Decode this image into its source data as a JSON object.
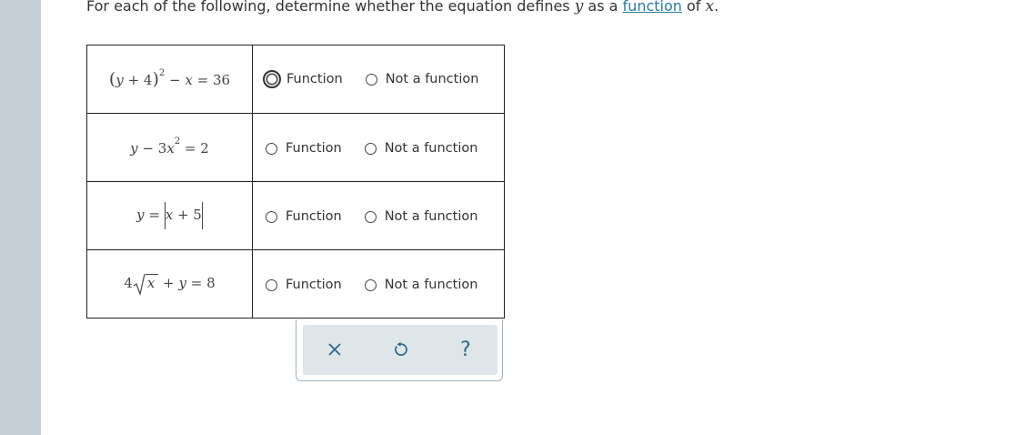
{
  "prompt": {
    "text_before": "For each of the following, determine whether the equation defines ",
    "var_y": "y",
    "text_middle": " as a ",
    "link_text": "function",
    "text_of": " of ",
    "var_x": "x",
    "text_end": "."
  },
  "rows": [
    {
      "equation": {
        "open": "(",
        "y": "y",
        "plus4": " + 4",
        "close": ")",
        "exp": "2",
        "rest": " − ",
        "x": "x",
        "eq": " = 36"
      },
      "option1": "Function",
      "option2": "Not a function"
    },
    {
      "equation": {
        "y": "y",
        "minus": " − 3",
        "x": "x",
        "exp": "2",
        "eq": " = 2"
      },
      "option1": "Function",
      "option2": "Not a function"
    },
    {
      "equation": {
        "y": "y",
        "eq": " = ",
        "x": "x",
        "plus5": " + 5"
      },
      "option1": "Function",
      "option2": "Not a function"
    },
    {
      "equation": {
        "coef": "4",
        "x": "x",
        "plusy": " + ",
        "y": "y",
        "eq": " = 8"
      },
      "option1": "Function",
      "option2": "Not a function"
    }
  ],
  "toolbar": {
    "clear_icon": "close-icon",
    "undo_icon": "undo-icon",
    "help_label": "?",
    "colors": {
      "icon": "#2a6a8a",
      "bg": "#dfe6ea"
    }
  }
}
